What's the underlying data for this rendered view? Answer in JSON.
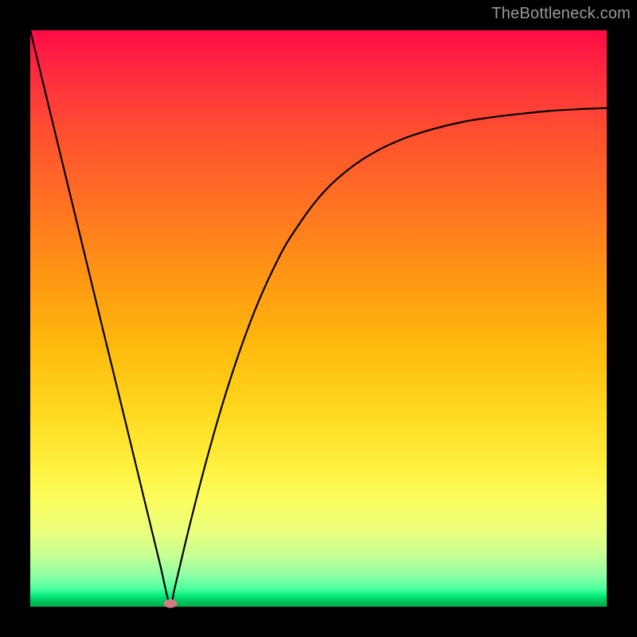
{
  "watermark": "TheBottleneck.com",
  "marker_color": "#cf7d81",
  "chart_data": {
    "type": "line",
    "title": "",
    "xlabel": "",
    "ylabel": "",
    "xlim": [
      0,
      100
    ],
    "ylim": [
      0,
      100
    ],
    "grid": false,
    "x": [
      0.0,
      2.5,
      5.0,
      7.5,
      10.0,
      12.5,
      15.0,
      17.5,
      20.0,
      22.5,
      24.3,
      25.0,
      27.5,
      30.0,
      32.5,
      35.0,
      37.5,
      40.0,
      42.5,
      45.0,
      50.0,
      55.0,
      60.0,
      65.0,
      70.0,
      75.0,
      80.0,
      85.0,
      90.0,
      95.0,
      100.0
    ],
    "y": [
      100.0,
      89.7,
      79.4,
      69.1,
      58.8,
      48.5,
      38.3,
      28.0,
      17.7,
      7.4,
      0.0,
      3.0,
      13.5,
      23.3,
      32.3,
      40.4,
      47.6,
      53.9,
      59.3,
      63.9,
      70.9,
      75.7,
      79.0,
      81.3,
      82.9,
      84.1,
      84.9,
      85.5,
      86.0,
      86.3,
      86.5
    ],
    "annotations": [
      {
        "type": "marker",
        "x": 24.3,
        "y": 0.5,
        "label": "minimum-marker"
      }
    ],
    "background": "vertical-gradient red→yellow→green",
    "series_color": "#000000"
  }
}
